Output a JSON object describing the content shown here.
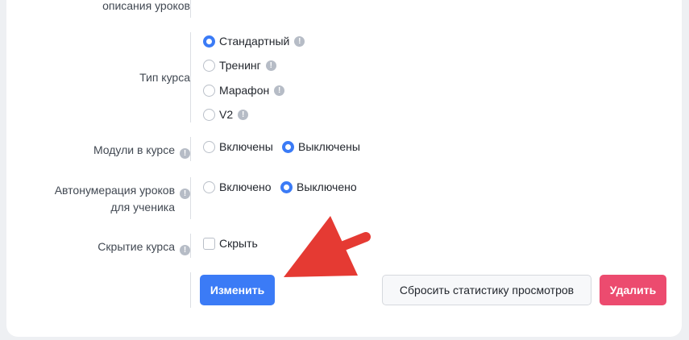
{
  "form": {
    "lesson_descriptions_label_tail": "описания уроков",
    "course_type": {
      "label": "Тип курса",
      "options": [
        "Стандартный",
        "Тренинг",
        "Марафон",
        "V2"
      ],
      "selected": "Стандартный"
    },
    "modules": {
      "label": "Модули в курсе",
      "options": [
        "Включены",
        "Выключены"
      ],
      "selected": "Выключены"
    },
    "autonumbering": {
      "label_line1": "Автонумерация уроков",
      "label_line2": "для ученика",
      "options": [
        "Включено",
        "Выключено"
      ],
      "selected": "Выключено"
    },
    "hide_course": {
      "label": "Скрытие курса",
      "checkbox_label": "Скрыть",
      "checked": false
    }
  },
  "buttons": {
    "edit": "Изменить",
    "reset_stats": "Сбросить статистику просмотров",
    "delete": "Удалить"
  },
  "colors": {
    "primary": "#3b7bf6",
    "danger": "#ec4b6f",
    "arrow": "#e53a33"
  },
  "icons": {
    "info": "info-icon",
    "annotation": "red-arrow"
  }
}
